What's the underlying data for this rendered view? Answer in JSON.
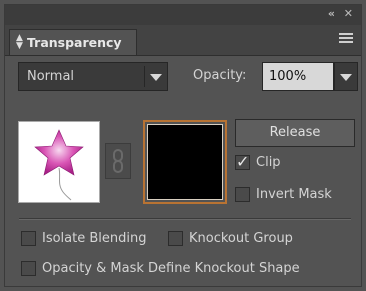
{
  "window": {
    "collapse_icon": "«",
    "close_icon": "✕"
  },
  "tab": {
    "label": "Transparency"
  },
  "blend": {
    "mode": "Normal"
  },
  "opacity": {
    "label": "Opacity:",
    "value": "100%"
  },
  "buttons": {
    "release": "Release"
  },
  "checkboxes": {
    "clip": {
      "label": "Clip",
      "checked": true
    },
    "invert_mask": {
      "label": "Invert Mask",
      "checked": false
    },
    "isolate_blending": {
      "label": "Isolate Blending",
      "checked": false
    },
    "knockout_group": {
      "label": "Knockout Group",
      "checked": false
    },
    "opacity_mask_knockout": {
      "label": "Opacity & Mask Define Knockout Shape",
      "checked": false
    }
  },
  "icons": {
    "tab": "up-down-arrows-icon",
    "menu": "panel-menu-icon",
    "link": "chain-link-icon",
    "artwork": "pink-star-balloon-thumbnail"
  }
}
